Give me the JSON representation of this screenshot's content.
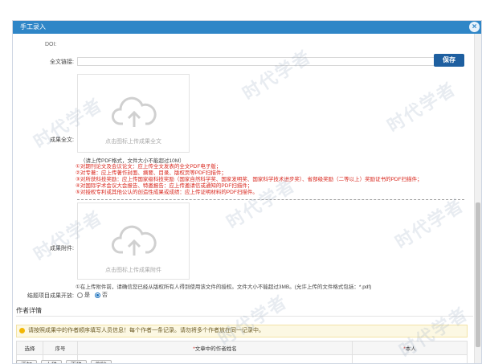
{
  "dialog": {
    "title": "手工录入",
    "close_glyph": "×"
  },
  "form": {
    "cut_label": "DOI:",
    "fulltext_link_label": "全文链接:",
    "save_label": "保存",
    "fulltext_label": "成果全文:",
    "upload_fulltext_caption": "点击图标上传成果全文",
    "fulltext_hint": "（请上传PDF格式，文件大小不能超过10M）",
    "requirements": [
      "①对期刊论文及会议论文：应上传全文发表的全文PDF电子版；",
      "②对专著：应上传著作封面、摘要、目录、版权页等PDF扫描件；",
      "③对所获科技奖励：应上传国家级科技奖励（国家自然科学奖、国家发明奖、国家科学技术进步奖）、省部级奖励（二等以上）奖励证书的PDF扫描件；",
      "④对国际学术会议大会报告、特邀报告：应上传邀请信或通知的PDF扫描件；",
      "⑤对授权专利或其他公认的创造性成果或成绩：应上传证明材料的PDF扫描件。"
    ],
    "attachment_label": "成果附件:",
    "upload_attachment_caption": "点击图标上传成果附件",
    "attachment_hint": "①在上传附件前，请确信您已经从版权所有人得到使用该文件的授权。文件大小不能超过3MB。(允许上传的文件格式包括：*.pdf)",
    "open_label": "结题项目成果开放:",
    "radio_yes": "是",
    "radio_no": "否"
  },
  "authors": {
    "section_title": "作者详情",
    "notice": "请按照成果中的作者顺序填写人员信息！每个作者一条记录。请勿将多个作者放在同一记录中。",
    "columns": [
      "选择",
      "序号",
      "文章中的作者姓名",
      "本人"
    ],
    "buttons": [
      "添加",
      "上移",
      "下移",
      "删除"
    ]
  },
  "watermark_text": "时代学者",
  "colors": {
    "titlebar": "#2f86c7",
    "save_button": "#1e5fa0",
    "required_text": "#d9261c",
    "notice_bg": "#fcf8e3"
  },
  "icons": [
    "close-icon",
    "cloud-upload-icon",
    "lightbulb-icon"
  ]
}
